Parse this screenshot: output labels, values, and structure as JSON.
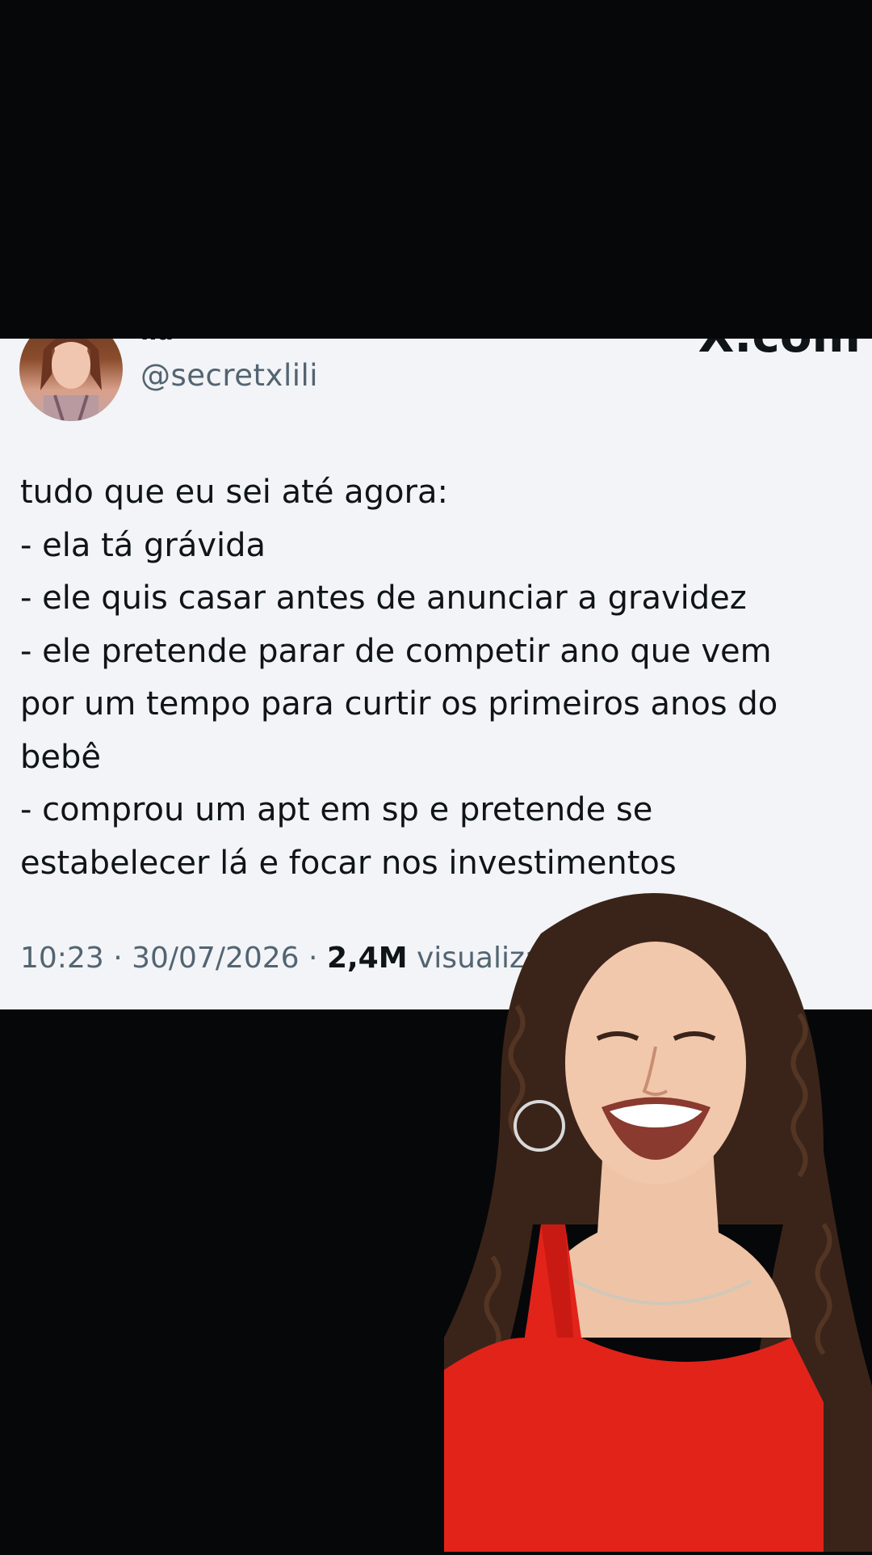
{
  "tweet": {
    "display_name": "lia",
    "handle": "@secretxlili",
    "watermark": "X.com",
    "text_lines": [
      "tudo que eu sei até agora:",
      "- ela tá grávida",
      "- ele quis casar antes de anunciar a gravidez",
      "- ele pretende parar de competir ano que vem",
      "por um tempo para curtir os primeiros anos do",
      "bebê",
      "- comprou um apt em sp e pretende se",
      "estabelecer lá e focar nos investimentos"
    ],
    "time": "10:23",
    "separator": " · ",
    "date": "30/07/2026",
    "views_count": "2,4M",
    "views_label": "visualiza"
  },
  "icons": {
    "avatar": "profile-photo",
    "presenter": "woman-smiling-red-top"
  },
  "colors": {
    "background": "#060709",
    "card": "#f2f4f7",
    "text": "#0f1419",
    "secondary_text": "#536471",
    "presenter_top": "#e2231a"
  }
}
